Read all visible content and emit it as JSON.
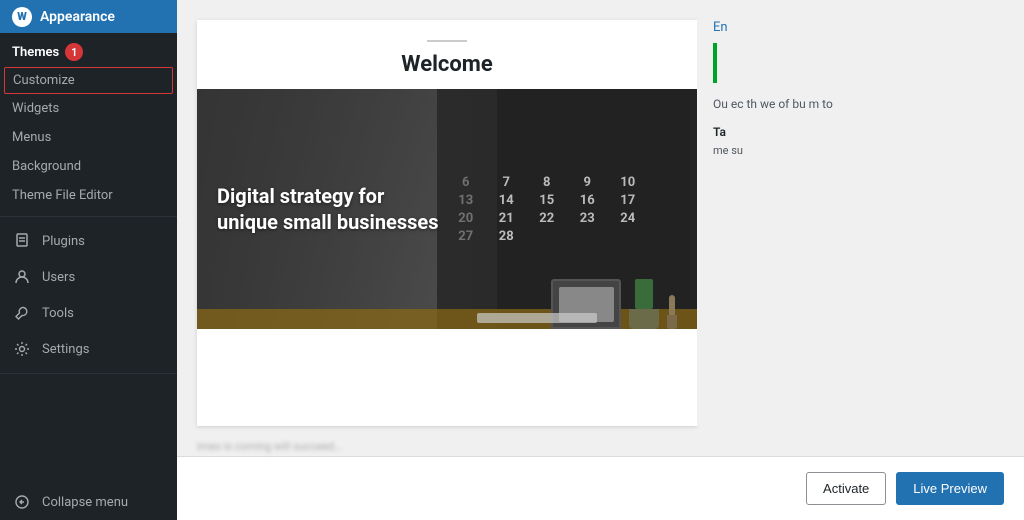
{
  "sidebar": {
    "header": {
      "title": "Appearance",
      "icon": "appearance-icon"
    },
    "themes_section": {
      "label": "Themes",
      "badge": "1"
    },
    "items": [
      {
        "id": "customize",
        "label": "Customize",
        "active": true
      },
      {
        "id": "widgets",
        "label": "Widgets"
      },
      {
        "id": "menus",
        "label": "Menus"
      },
      {
        "id": "background",
        "label": "Background"
      },
      {
        "id": "theme-file-editor",
        "label": "Theme File Editor"
      }
    ],
    "groups": [
      {
        "id": "plugins",
        "label": "Plugins",
        "icon": "plugin-icon"
      },
      {
        "id": "users",
        "label": "Users",
        "icon": "user-icon"
      },
      {
        "id": "tools",
        "label": "Tools",
        "icon": "tools-icon"
      },
      {
        "id": "settings",
        "label": "Settings",
        "icon": "settings-icon"
      }
    ],
    "collapse_label": "Collapse menu"
  },
  "preview": {
    "welcome_line": "",
    "welcome_title": "Welcome",
    "hero_text": "Digital strategy for unique small businesses",
    "calendar_numbers": [
      "6",
      "7",
      "8",
      "9",
      "10",
      "13",
      "14",
      "15",
      "16",
      "17",
      "20",
      "21",
      "22",
      "23",
      "24",
      "27",
      "28",
      "",
      "",
      ""
    ]
  },
  "side_panel": {
    "link_text": "En",
    "description": "Ou ec th we of bu m to",
    "tag_label": "Ta",
    "tag_text": "me su"
  },
  "bottom_bar": {
    "activate_label": "Activate",
    "live_preview_label": "Live Preview"
  },
  "bottom_strip": {
    "text": "imes is coming will succeed..."
  }
}
